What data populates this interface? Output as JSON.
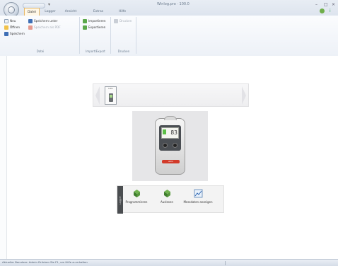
{
  "window": {
    "title": "Winlog.pro · 100.0",
    "controls": [
      "–",
      "□",
      "×"
    ]
  },
  "ribbon": {
    "tabs": [
      "Datei",
      "Logger",
      "Ansicht",
      "Extras",
      "Hilfe"
    ],
    "active_tab": "Datei",
    "groups": [
      {
        "label": "Datei",
        "buttons": [
          {
            "label": "Neu",
            "icon": "new-file-icon",
            "enabled": true
          },
          {
            "label": "Öffnen",
            "icon": "open-folder-icon",
            "enabled": true
          },
          {
            "label": "Speichern",
            "icon": "save-icon",
            "enabled": true
          },
          {
            "label": "Speichern unter",
            "icon": "save-as-icon",
            "enabled": true
          },
          {
            "label": "Speichern als PDF",
            "icon": "pdf-icon",
            "enabled": false
          }
        ]
      },
      {
        "label": "Import/Export",
        "buttons": [
          {
            "label": "Importieren",
            "icon": "import-icon",
            "enabled": true
          },
          {
            "label": "Exportieren",
            "icon": "export-icon",
            "enabled": true
          }
        ]
      },
      {
        "label": "Drucken",
        "buttons": [
          {
            "label": "Drucken",
            "icon": "print-icon",
            "enabled": false
          }
        ]
      }
    ]
  },
  "carousel": {
    "items": [
      {
        "label": "LOG",
        "icon": "data-logger-thumbnail"
      }
    ]
  },
  "device": {
    "display": "83",
    "brand": "ebro"
  },
  "actionbar": {
    "side_label": "Logger",
    "actions": [
      {
        "label": "Programmieren",
        "icon": "program-logger-icon"
      },
      {
        "label": "Auslesen",
        "icon": "read-logger-icon"
      },
      {
        "label": "Messdaten anzeigen",
        "icon": "show-data-chart-icon"
      }
    ]
  },
  "status": {
    "text": "Aktueller Benutzer: Admin   Drücken Sie F1, um Hilfe zu erhalten"
  },
  "colors": {
    "accent": "#e7b969",
    "ribbon_bg": "#edf1f7",
    "status_bg": "#d6dde8",
    "logo_red": "#d23b2a"
  }
}
